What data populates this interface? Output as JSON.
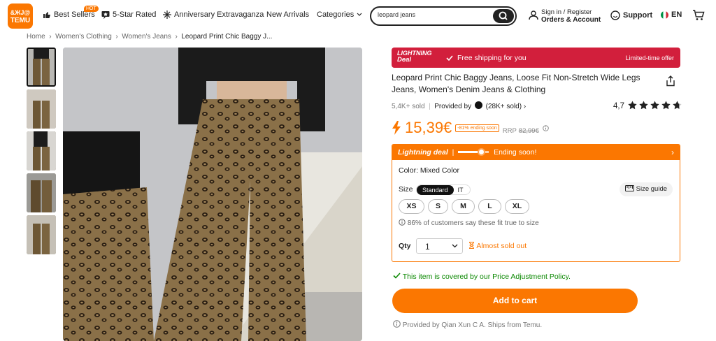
{
  "header": {
    "logo_line1": "&ЖJ@",
    "logo_line2": "TEMU",
    "best_sellers": "Best Sellers",
    "hot_badge": "HOT",
    "five_star": "5-Star Rated",
    "anniversary": "Anniversary Extravaganza",
    "new_arrivals": "New Arrivals",
    "categories": "Categories",
    "search_value": "leopard jeans",
    "signin": "Sign in / Register",
    "orders": "Orders & Account",
    "support": "Support",
    "language": "EN"
  },
  "breadcrumb": [
    "Home",
    "Women's Clothing",
    "Women's Jeans",
    "Leopard Print Chic Baggy J..."
  ],
  "banner": {
    "logo_line1": "LIGHTNING",
    "logo_line2": "Deal",
    "shipping": "Free shipping for you",
    "offer": "Limited-time offer"
  },
  "product": {
    "title": "Leopard Print Chic Baggy Jeans, Loose Fit Non-Stretch Wide Legs Jeans, Women's Denim Jeans & Clothing",
    "sold": "5,4K+ sold",
    "provided_by": "Provided by",
    "seller_sold": "(28K+ sold)",
    "rating": "4,7",
    "stars": 4.7,
    "price": "15,39€",
    "discount": "-81% ending soon",
    "rrp_label": "RRP",
    "rrp": "82,99€"
  },
  "lightning": {
    "label": "Lightning deal",
    "ending": "Ending soon!",
    "progress": 0.75
  },
  "options": {
    "color_label": "Color: Mixed Color",
    "size_label": "Size",
    "size_std": "Standard",
    "size_it": "IT",
    "size_guide": "Size guide",
    "sizes": [
      "XS",
      "S",
      "M",
      "L",
      "XL"
    ],
    "fit_note": "86% of customers say these fit true to size",
    "qty_label": "Qty",
    "qty_value": "1",
    "almost_sold": "Almost sold out"
  },
  "policy": "This item is covered by our Price Adjustment Policy.",
  "add_to_cart": "Add to cart",
  "provided_footer": "Provided by Qian Xun C A. Ships from Temu.",
  "colors": {
    "accent": "#fb7701",
    "banner": "#d21f3c",
    "green": "#0a8800"
  }
}
